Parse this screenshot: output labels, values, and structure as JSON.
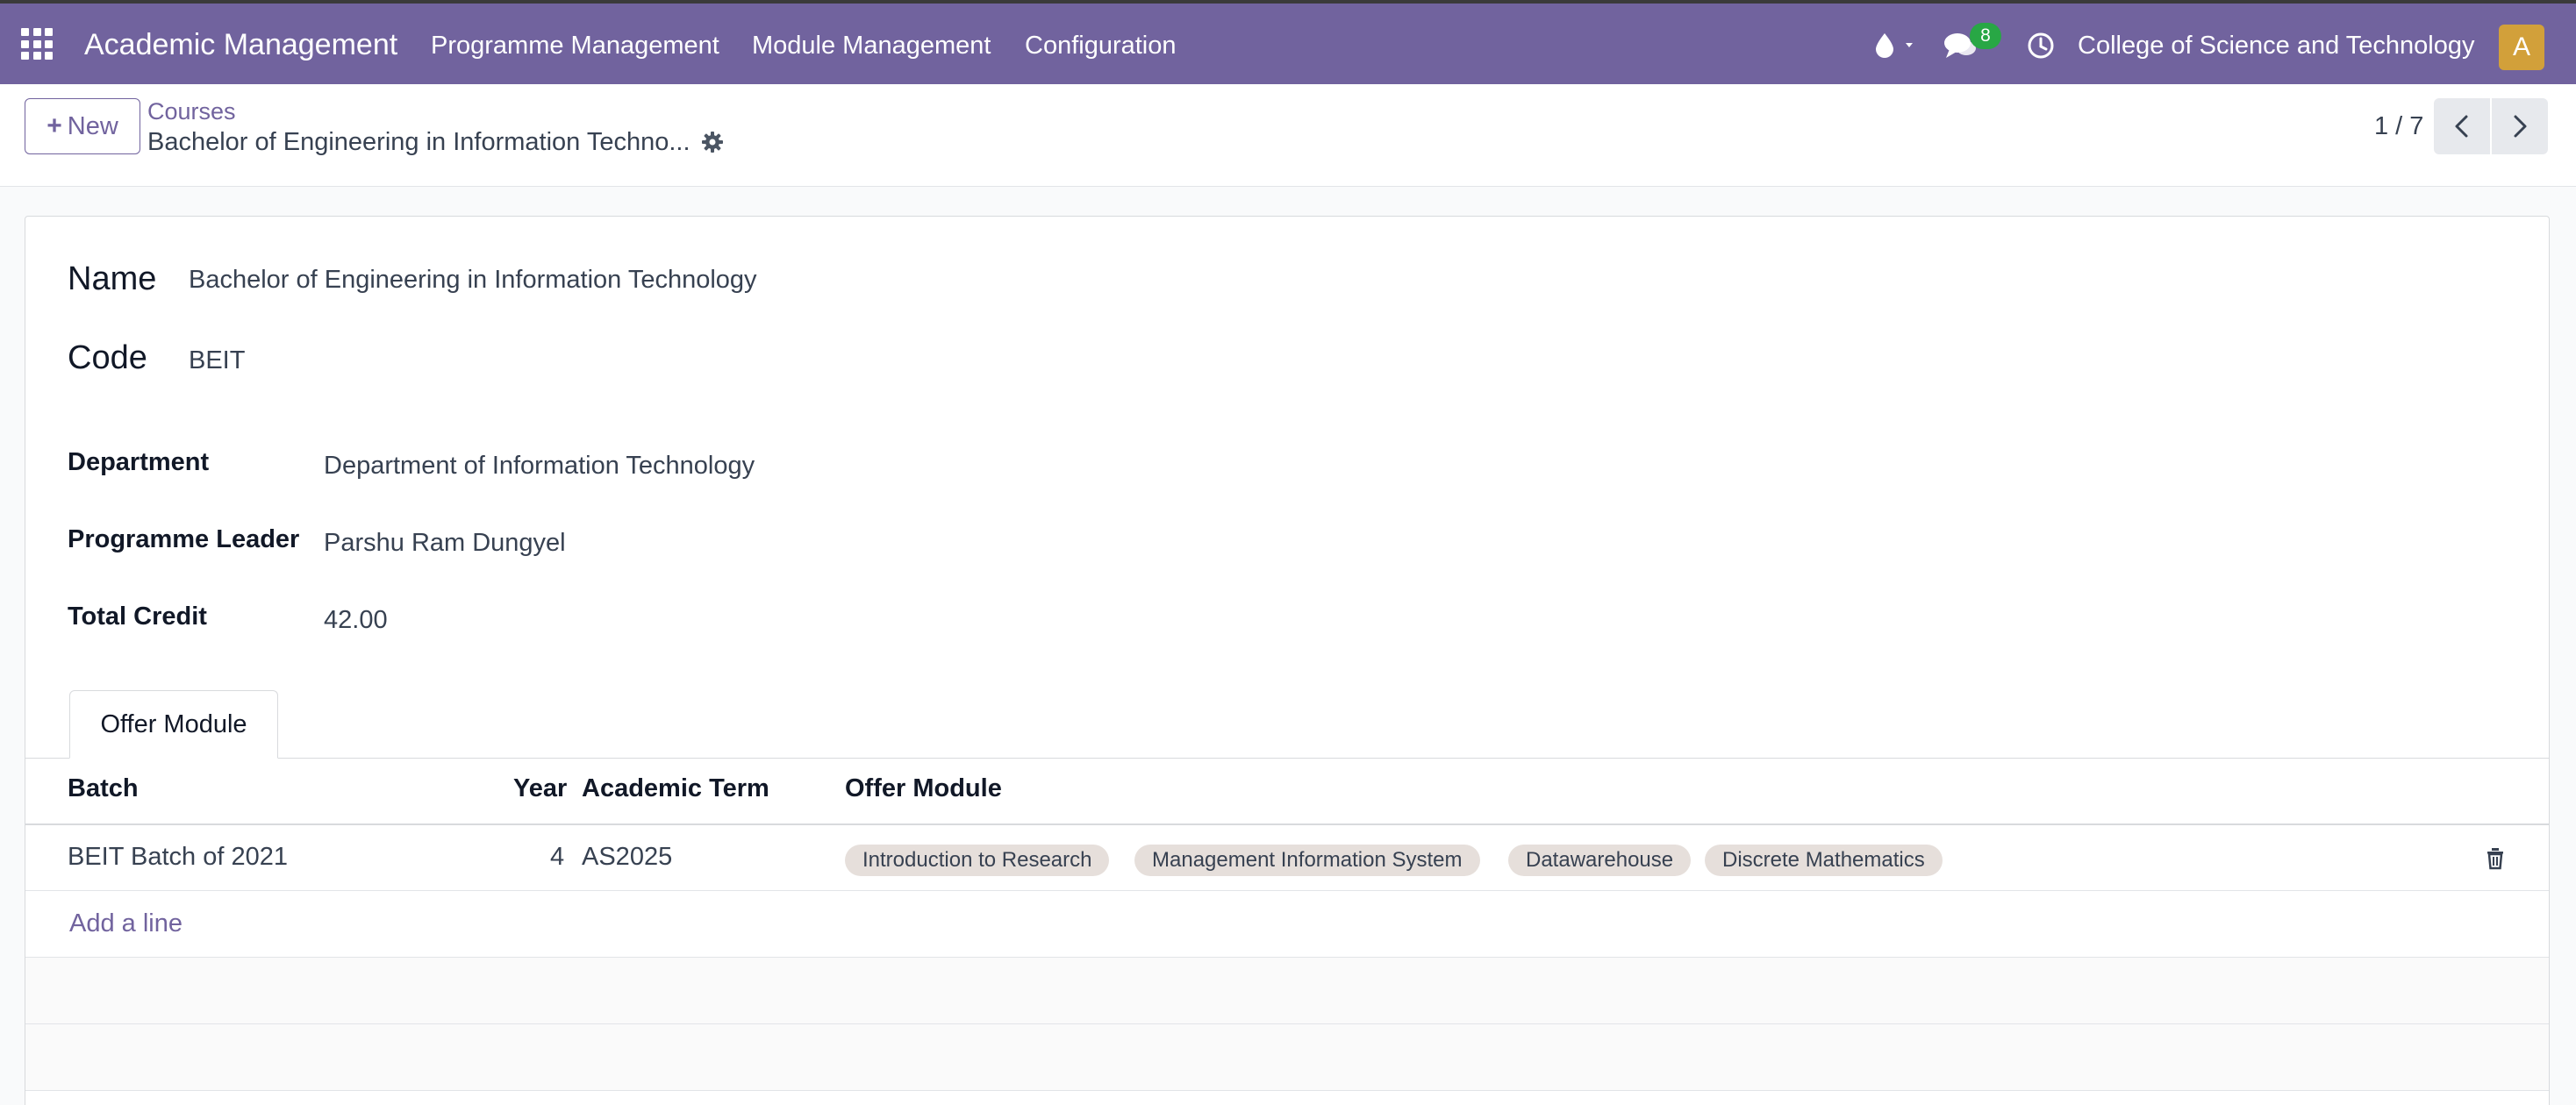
{
  "navbar": {
    "app_title": "Academic Management",
    "menu": [
      "Programme Management",
      "Module Management",
      "Configuration"
    ],
    "message_count": "8",
    "company": "College of Science and Technology",
    "avatar_initial": "A",
    "color": "#71639e"
  },
  "control_panel": {
    "new_label": "New",
    "breadcrumb_parent": "Courses",
    "breadcrumb_current": "Bachelor of Engineering in Information Techno...",
    "pager": "1 / 7"
  },
  "form": {
    "name_label": "Name",
    "name_value": "Bachelor of Engineering in Information Technology",
    "code_label": "Code",
    "code_value": "BEIT",
    "department_label": "Department",
    "department_value": "Department of Information Technology",
    "leader_label": "Programme Leader",
    "leader_value": "Parshu Ram Dungyel",
    "credit_label": "Total Credit",
    "credit_value": "42.00"
  },
  "tabs": [
    {
      "label": "Offer Module",
      "active": true
    }
  ],
  "table": {
    "headers": {
      "batch": "Batch",
      "year": "Year",
      "term": "Academic Term",
      "modules": "Offer Module"
    },
    "rows": [
      {
        "batch": "BEIT Batch of 2021",
        "year": "4",
        "term": "AS2025",
        "modules": [
          "Introduction to Research",
          "Management Information System",
          "Datawarehouse",
          "Discrete Mathematics"
        ]
      }
    ],
    "add_line": "Add a line"
  }
}
